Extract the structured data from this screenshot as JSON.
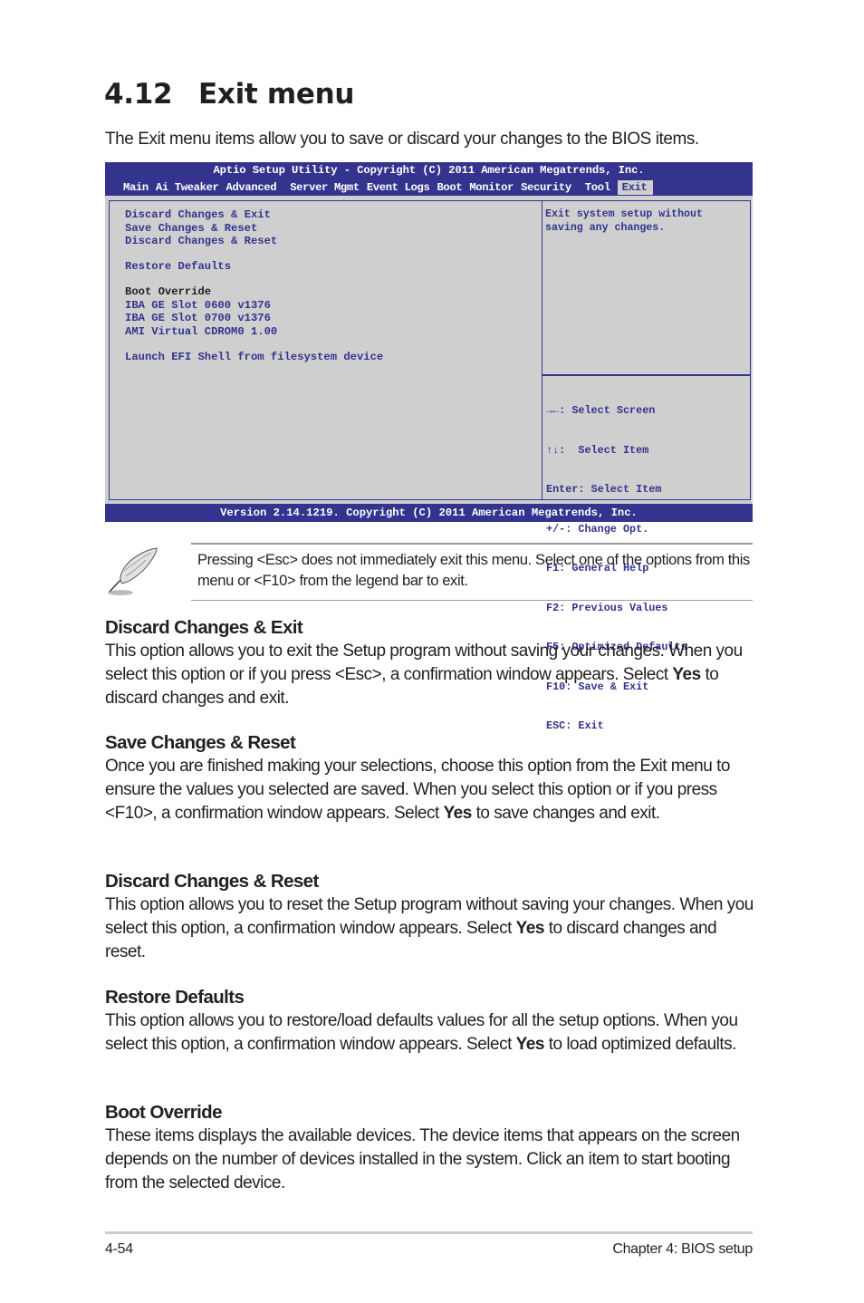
{
  "page": {
    "section_number": "4.12",
    "title": "Exit menu",
    "intro": "The Exit menu items allow you to save or discard your changes to the BIOS items."
  },
  "bios": {
    "title": "Aptio Setup Utility - Copyright (C) 2011 American Megatrends, Inc.",
    "tabs": [
      {
        "label": "Main",
        "active": false
      },
      {
        "label": "Ai Tweaker",
        "active": false
      },
      {
        "label": "Advanced",
        "active": false
      },
      {
        "label": "Server Mgmt",
        "active": false
      },
      {
        "label": "Event Logs",
        "active": false
      },
      {
        "label": "Boot",
        "active": false
      },
      {
        "label": "Monitor",
        "active": false
      },
      {
        "label": "Security",
        "active": false
      },
      {
        "label": "Tool",
        "active": false
      },
      {
        "label": "Exit",
        "active": true
      }
    ],
    "menu": {
      "discard_exit": "Discard Changes & Exit",
      "save_reset": "Save Changes & Reset",
      "discard_reset": "Discard Changes & Reset",
      "restore_defaults": "Restore Defaults",
      "boot_override_label": "Boot Override",
      "boot_devices": [
        "IBA GE Slot 0600 v1376",
        "IBA GE Slot 0700 v1376",
        "AMI Virtual CDROM0 1.00"
      ],
      "launch_efi": "Launch EFI Shell from filesystem device"
    },
    "help_text": [
      "Exit system setup without",
      "saving any changes."
    ],
    "legend": [
      "→←: Select Screen",
      "↑↓:  Select Item",
      "Enter: Select Item",
      "+/-: Change Opt.",
      "F1: General Help",
      "F2: Previous Values",
      "F5: Optimized Defaults",
      "F10: Save & Exit",
      "ESC: Exit"
    ],
    "footer": "Version 2.14.1219. Copyright (C) 2011 American Megatrends, Inc.",
    "colors": {
      "header_bg": "#34348e",
      "screen_bg": "#cfcfcf",
      "item_text": "#33338f"
    }
  },
  "note": {
    "icon": "feather-pen-icon",
    "text": "Pressing <Esc> does not immediately exit this menu. Select one of the options from this menu or <F10> from the legend bar to exit."
  },
  "sections": [
    {
      "heading": "Discard Changes & Exit",
      "before": "This option allows you to exit the Setup program without saving your changes. When you select this option or if you press <Esc>, a confirmation window appears. Select ",
      "bold": "Yes",
      "after": " to discard changes and exit."
    },
    {
      "heading": "Save Changes & Reset",
      "before": "Once you are finished making your selections, choose this option from the Exit menu to ensure the values you selected are saved. When you select this option or if you press <F10>, a confirmation window appears. Select ",
      "bold": "Yes",
      "after": " to save changes and exit."
    },
    {
      "heading": "Discard Changes & Reset",
      "before": "This option allows you to reset the Setup program without saving your changes. When you select this option, a confirmation window appears. Select ",
      "bold": "Yes",
      "after": " to discard changes and reset."
    },
    {
      "heading": "Restore Defaults",
      "before": "This option allows you to restore/load defaults values for all the setup options. When you select this option, a confirmation window appears. Select ",
      "bold": "Yes",
      "after": " to load optimized defaults."
    },
    {
      "heading": "Boot Override",
      "before": "These items displays the available devices. The device items that appears on the screen depends on the number of devices installed in the system. Click an item to start booting from the selected device.",
      "bold": "",
      "after": ""
    }
  ],
  "footer": {
    "page_number": "4-54",
    "chapter": "Chapter 4: BIOS setup"
  }
}
